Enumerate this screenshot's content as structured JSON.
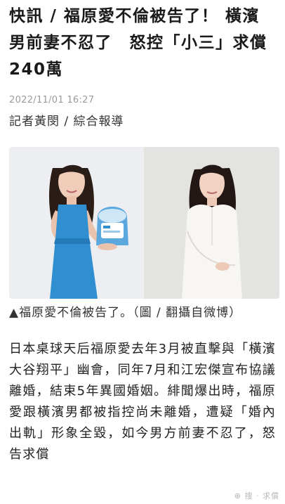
{
  "article": {
    "headline": "快訊 / 福原愛不倫被告了！ 橫濱男前妻不忍了　怒控「小三」求償240萬",
    "datetime": "2022/11/01 16:27",
    "byline": "記者黃閔 / 綜合報導",
    "caption": "▲福原愛不倫被告了。（圖 / 翻攝自微博）",
    "body": "日本桌球天后福原愛去年3月被直擊與「橫濱大谷翔平」幽會，同年7月和江宏傑宣布協議離婚，結束5年異國婚姻。緋聞爆出時，福原愛跟橫濱男都被指控尚未離婚，遭疑「婚內出軌」形象全毀，如今男方前妻不忍了，怒告求償"
  },
  "watermark": "⊕ 搜 · 求償",
  "colors": {
    "left_bg": "#eceef1",
    "right_bg": "#e3e3e2",
    "dress_blue": "#2f8fd0",
    "blouse_white": "#f7f6f2",
    "hair": "#2a1d17",
    "skin": "#f0cdb8",
    "date_gray": "#9a9a9a"
  }
}
